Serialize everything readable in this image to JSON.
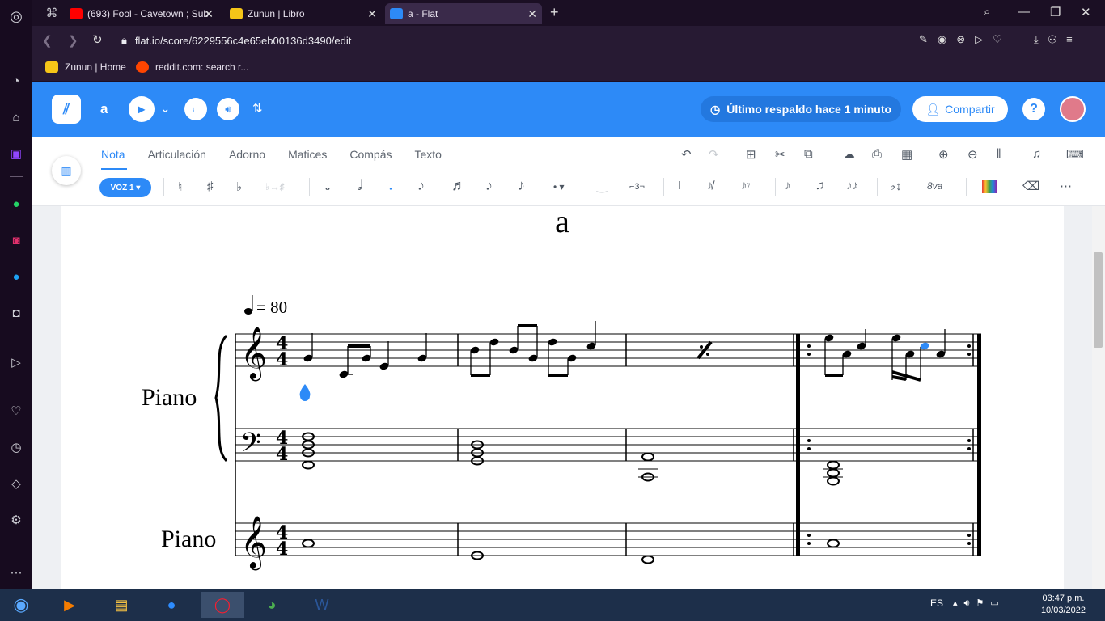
{
  "browser": {
    "tabs": [
      {
        "title": "(693) Fool - Cavetown ; Sub",
        "fav_color": "#ff0000"
      },
      {
        "title": "Zunun | Libro",
        "fav_color": "#f5c518"
      },
      {
        "title": "a - Flat",
        "fav_color": "#2d8af7"
      }
    ],
    "url": "flat.io/score/6229556c4e65eb00136d3490/edit",
    "bookmarks": [
      "Zunun | Home",
      "reddit.com: search r..."
    ]
  },
  "app": {
    "score_name": "a",
    "backup_status": "Último respaldo hace 1 minuto",
    "share_label": "Compartir",
    "help_label": "?"
  },
  "toolbar": {
    "tabs": [
      "Nota",
      "Articulación",
      "Adorno",
      "Matices",
      "Compás",
      "Texto"
    ],
    "voice_label": "VOZ 1 ▾",
    "tuplet_label": "⌐3¬",
    "ottava_label": "8va"
  },
  "score": {
    "title": "a",
    "tempo": "= 80",
    "parts": [
      "Piano",
      "Piano"
    ],
    "time_signature": "4/4"
  },
  "taskbar": {
    "lang": "ES",
    "time": "03:47 p.m.",
    "date": "10/03/2022"
  },
  "colors": {
    "accent": "#2d8af7",
    "selected_note": "#2d8af7"
  }
}
